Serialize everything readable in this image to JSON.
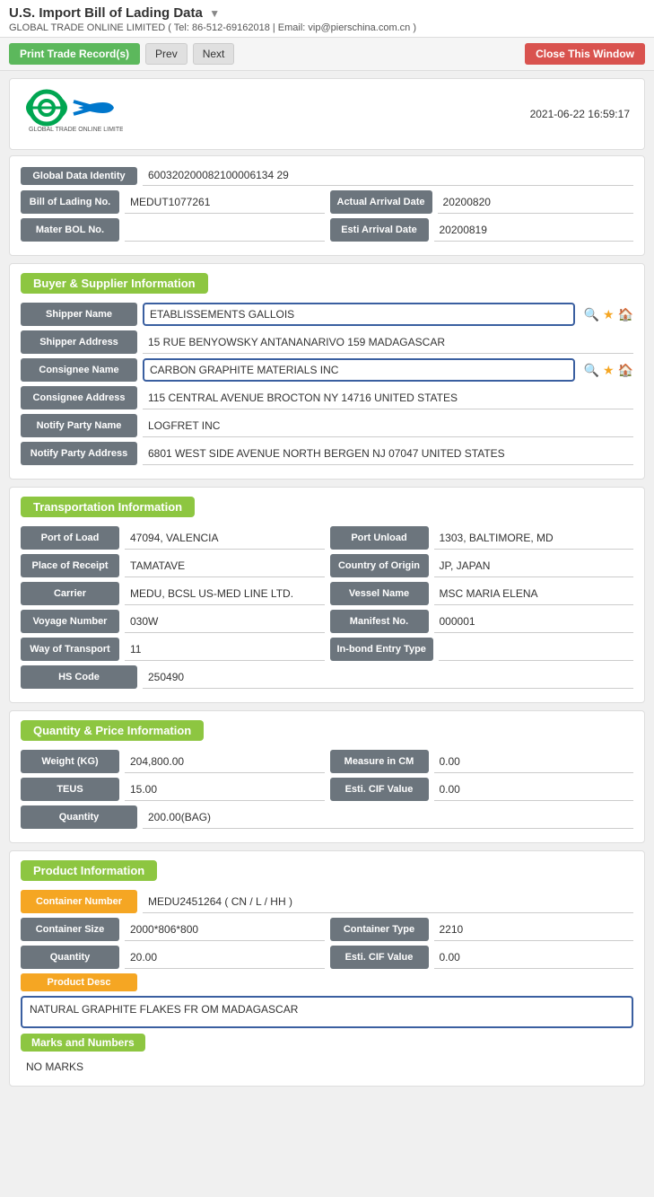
{
  "page": {
    "title": "U.S. Import Bill of Lading Data",
    "title_arrow": "▼",
    "company_info": "GLOBAL TRADE ONLINE LIMITED ( Tel: 86-512-69162018 | Email: vip@pierschina.com.cn )",
    "timestamp": "2021-06-22 16:59:17"
  },
  "toolbar": {
    "print_label": "Print Trade Record(s)",
    "prev_label": "Prev",
    "next_label": "Next",
    "close_label": "Close This Window"
  },
  "identity_card": {
    "global_data_identity_label": "Global Data Identity",
    "global_data_identity_value": "600320200082100006134 29",
    "bill_of_lading_label": "Bill of Lading No.",
    "bill_of_lading_value": "MEDUT1077261",
    "actual_arrival_label": "Actual Arrival Date",
    "actual_arrival_value": "20200820",
    "mater_bol_label": "Mater BOL No.",
    "mater_bol_value": "",
    "esti_arrival_label": "Esti Arrival Date",
    "esti_arrival_value": "20200819"
  },
  "buyer_supplier": {
    "section_title": "Buyer & Supplier Information",
    "shipper_name_label": "Shipper Name",
    "shipper_name_value": "ETABLISSEMENTS GALLOIS",
    "shipper_address_label": "Shipper Address",
    "shipper_address_value": "15 RUE BENYOWSKY ANTANANARIVO 159 MADAGASCAR",
    "consignee_name_label": "Consignee Name",
    "consignee_name_value": "CARBON GRAPHITE MATERIALS INC",
    "consignee_address_label": "Consignee Address",
    "consignee_address_value": "115 CENTRAL AVENUE BROCTON NY 14716 UNITED STATES",
    "notify_party_name_label": "Notify Party Name",
    "notify_party_name_value": "LOGFRET INC",
    "notify_party_address_label": "Notify Party Address",
    "notify_party_address_value": "6801 WEST SIDE AVENUE NORTH BERGEN NJ 07047 UNITED STATES"
  },
  "transportation": {
    "section_title": "Transportation Information",
    "port_of_load_label": "Port of Load",
    "port_of_load_value": "47094, VALENCIA",
    "port_unload_label": "Port Unload",
    "port_unload_value": "1303, BALTIMORE, MD",
    "place_of_receipt_label": "Place of Receipt",
    "place_of_receipt_value": "TAMATAVE",
    "country_of_origin_label": "Country of Origin",
    "country_of_origin_value": "JP, JAPAN",
    "carrier_label": "Carrier",
    "carrier_value": "MEDU, BCSL US-MED LINE LTD.",
    "vessel_name_label": "Vessel Name",
    "vessel_name_value": "MSC MARIA ELENA",
    "voyage_number_label": "Voyage Number",
    "voyage_number_value": "030W",
    "manifest_no_label": "Manifest No.",
    "manifest_no_value": "000001",
    "way_of_transport_label": "Way of Transport",
    "way_of_transport_value": "11",
    "in_bond_entry_label": "In-bond Entry Type",
    "in_bond_entry_value": "",
    "hs_code_label": "HS Code",
    "hs_code_value": "250490"
  },
  "quantity_price": {
    "section_title": "Quantity & Price Information",
    "weight_kg_label": "Weight (KG)",
    "weight_kg_value": "204,800.00",
    "measure_in_cm_label": "Measure in CM",
    "measure_in_cm_value": "0.00",
    "teus_label": "TEUS",
    "teus_value": "15.00",
    "esti_cif_label": "Esti. CIF Value",
    "esti_cif_value": "0.00",
    "quantity_label": "Quantity",
    "quantity_value": "200.00(BAG)"
  },
  "product_info": {
    "section_title": "Product Information",
    "container_number_label": "Container Number",
    "container_number_value": "MEDU2451264 ( CN / L / HH )",
    "container_size_label": "Container Size",
    "container_size_value": "2000*806*800",
    "container_type_label": "Container Type",
    "container_type_value": "2210",
    "quantity_label": "Quantity",
    "quantity_value": "20.00",
    "esti_cif_label": "Esti. CIF Value",
    "esti_cif_value": "0.00",
    "product_desc_label": "Product Desc",
    "product_desc_value": "NATURAL GRAPHITE FLAKES FR OM MADAGASCAR",
    "marks_and_numbers_label": "Marks and Numbers",
    "no_marks_value": "NO MARKS"
  }
}
